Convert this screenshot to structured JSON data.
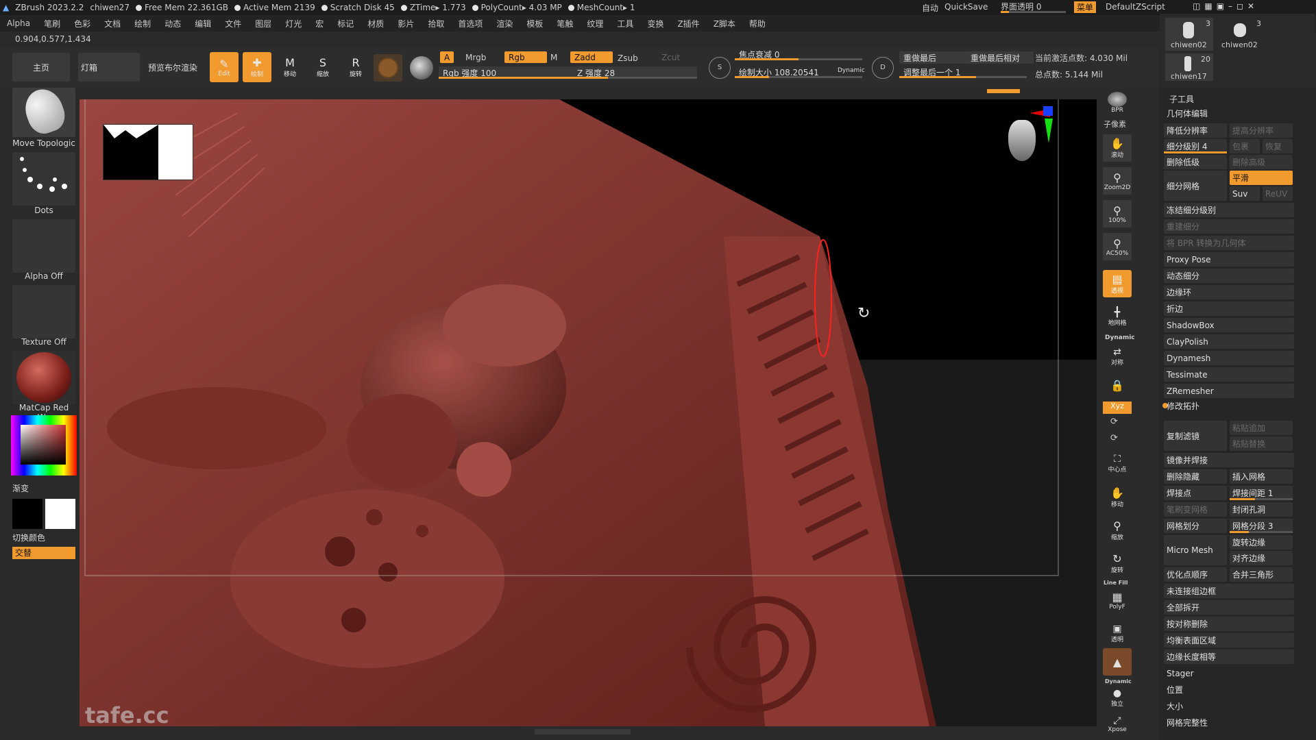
{
  "titlebar": {
    "app": "ZBrush 2023.2.2",
    "doc": "chiwen27",
    "free_mem": "Free Mem 22.361GB",
    "active_mem": "Active Mem 2139",
    "scratch": "Scratch Disk 45",
    "ztime": "ZTime▸ 1.773",
    "polycount": "PolyCount▸ 4.03 MP",
    "meshcount": "MeshCount▸ 1",
    "auto": "自动",
    "quicksave": "QuickSave",
    "transparency": "界面透明 0",
    "menu": "菜单",
    "script": "DefaultZScript"
  },
  "menubar": [
    "Alpha",
    "笔刷",
    "色彩",
    "文档",
    "绘制",
    "动态",
    "编辑",
    "文件",
    "图层",
    "灯光",
    "宏",
    "标记",
    "材质",
    "影片",
    "拾取",
    "首选项",
    "渲染",
    "模板",
    "笔触",
    "纹理",
    "工具",
    "变换",
    "Z插件",
    "Z脚本",
    "帮助"
  ],
  "coords": "0.904,0.577,1.434",
  "toolbar": {
    "home": "主页",
    "lightbox": "灯箱",
    "bpr_preview": "预览布尔渲染",
    "edit": "Edit",
    "draw": "绘制",
    "move": "移动",
    "scale": "缩放",
    "rotate": "旋转",
    "a_label": "A",
    "mrgb": "Mrgb",
    "rgb": "Rgb",
    "m": "M",
    "zadd": "Zadd",
    "zsub": "Zsub",
    "zcut": "Zcut",
    "rgb_intensity": "Rgb 强度 100",
    "z_intensity": "Z 强度 28",
    "focal_shift": "焦点衰减 0",
    "draw_size": "绘制大小 108.20541",
    "dynamic": "Dynamic",
    "replay_last": "重做最后",
    "replay_last_rel": "重做最后相对",
    "adjust_last": "调整最后一个 1",
    "active_points": "当前激活点数: 4.030 Mil",
    "total_points": "总点数: 5.144 Mil"
  },
  "subtools_top": [
    {
      "name": "chiwen02",
      "count": "3"
    },
    {
      "name": "chiwen02",
      "count": "3"
    },
    {
      "name": "chiwen17",
      "count": "20"
    }
  ],
  "leftshelf": {
    "brush": "Move Topologic",
    "stroke": "Dots",
    "alpha": "Alpha Off",
    "texture": "Texture Off",
    "material": "MatCap Red Wa",
    "gradient": "渐变",
    "switch_color": "切换颜色",
    "alternate": "交替"
  },
  "rightcol": {
    "bpr": "BPR",
    "subpixel": "子像素",
    "scroll": "滚动",
    "zoom2d": "Zoom2D",
    "actual": "100%",
    "ac50": "AC50%",
    "persp": "透视",
    "floor": "地网格",
    "dynamic": "Dynamic",
    "sym": "对称",
    "xyz": "Xyz",
    "frame": "中心点",
    "move": "移动",
    "zoom": "缩放",
    "rotate": "旋转",
    "linefill": "Line Fill",
    "polyf": "PolyF",
    "transp": "透明",
    "ghost": "Dynamic",
    "solo": "独立",
    "xpose": "Xpose"
  },
  "panel": {
    "subtool": "子工具",
    "geometry": "几何体编辑",
    "lower_res": "降低分辨率",
    "higher_res": "提高分辨率",
    "sdiv": "细分级别 4",
    "cage": "包裹",
    "rstr": "恢复",
    "del_lower": "删除低级",
    "del_higher": "删除高级",
    "divide": "细分网格",
    "smt": "平滑",
    "suv": "Suv",
    "reuv": "ReUV",
    "freeze": "冻结细分级别",
    "reconstruct": "重建细分",
    "bpr_to_geo": "将 BPR 转换为几何体",
    "proxy": "Proxy Pose",
    "dynsub": "动态细分",
    "edgeloop": "边缘环",
    "crease": "折边",
    "shadowbox": "ShadowBox",
    "claypolish": "ClayPolish",
    "dynamesh": "Dynamesh",
    "tessimate": "Tessimate",
    "zremesher": "ZRemesher",
    "modify_topo": "修改拓扑",
    "copy": "复制滤镜",
    "paste_append": "粘贴追加",
    "paste_replace": "粘贴替换",
    "mirror_weld": "镜像并焊接",
    "del_hidden": "删除隐藏",
    "insert_mesh": "插入网格",
    "weld_points": "焊接点",
    "weld_dist": "焊接间距 1",
    "mesh_from_brush": "笔刷变网格",
    "close_holes": "封闭孔洞",
    "grid_divide": "网格划分",
    "grid_seg": "网格分段 3",
    "spin_edge": "旋转边缘",
    "micromesh": "Micro Mesh",
    "align_edge": "对齐边缘",
    "optimize": "优化点顺序",
    "merge_tris": "合并三角形",
    "unweld_groups": "未连接组边框",
    "unweld_all": "全部拆开",
    "delete_by_sym": "按对称删除",
    "equalize_area": "均衡表面区域",
    "equalize_edge": "边缘长度相等",
    "stager": "Stager",
    "position": "位置",
    "size": "大小",
    "mesh_integrity": "网格完整性"
  },
  "watermark": "tafe.cc",
  "colors": {
    "accent": "#f19a2e",
    "bg": "#2a2a2a",
    "model": "#8a3a35"
  }
}
